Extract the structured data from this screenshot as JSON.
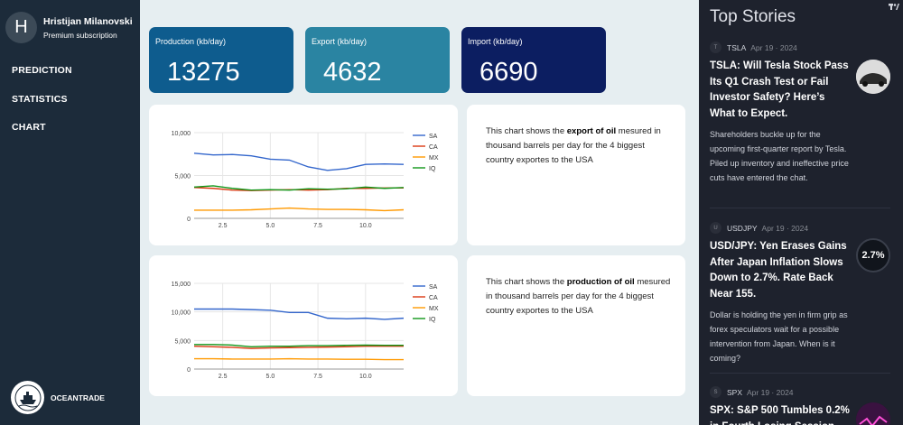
{
  "user": {
    "initial": "H",
    "name": "Hristijan Milanovski",
    "plan": "Premium subscription"
  },
  "nav": {
    "items": [
      {
        "label": "PREDICTION"
      },
      {
        "label": "STATISTICS"
      },
      {
        "label": "CHART"
      }
    ]
  },
  "brand": {
    "name": "OCEANTRADE"
  },
  "kpis": [
    {
      "label": "Production (kb/day)",
      "value": "13275",
      "color": "#0e5c8e"
    },
    {
      "label": "Export (kb/day)",
      "value": "4632",
      "color": "#2a84a2"
    },
    {
      "label": "Import (kb/day)",
      "value": "6690",
      "color": "#0c1e61"
    }
  ],
  "descriptions": [
    {
      "pre": "This chart shows the ",
      "bold": "export of oil",
      "post": " mesured in thousand barrels per day for the 4 biggest country exportes to the USA"
    },
    {
      "pre": "This chart shows the ",
      "bold": "production of oil",
      "post": " mesured in thousand barrels per day for the 4 biggest country exportes to the USA"
    }
  ],
  "chart_data": [
    {
      "type": "line",
      "x": [
        1,
        2,
        3,
        4,
        5,
        6,
        7,
        8,
        9,
        10,
        11,
        12
      ],
      "xticks": [
        "2.5",
        "5.0",
        "7.5",
        "10.0"
      ],
      "yticks": [
        "0",
        "5,000",
        "10,000"
      ],
      "ylim": [
        0,
        10000
      ],
      "xlim": [
        1,
        12
      ],
      "legend": "right",
      "grid": true,
      "series": [
        {
          "name": "SA",
          "color": "#3366cc",
          "values": [
            7600,
            7400,
            7450,
            7300,
            6900,
            6800,
            6000,
            5600,
            5800,
            6300,
            6350,
            6300
          ]
        },
        {
          "name": "CA",
          "color": "#dc3912",
          "values": [
            3600,
            3500,
            3300,
            3250,
            3300,
            3350,
            3300,
            3350,
            3500,
            3500,
            3550,
            3550
          ]
        },
        {
          "name": "MX",
          "color": "#ff9900",
          "values": [
            950,
            950,
            950,
            1000,
            1100,
            1200,
            1100,
            1050,
            1050,
            1000,
            900,
            1000
          ]
        },
        {
          "name": "IQ",
          "color": "#109618",
          "values": [
            3650,
            3800,
            3500,
            3300,
            3350,
            3300,
            3450,
            3400,
            3450,
            3650,
            3500,
            3600
          ]
        }
      ]
    },
    {
      "type": "line",
      "x": [
        1,
        2,
        3,
        4,
        5,
        6,
        7,
        8,
        9,
        10,
        11,
        12
      ],
      "xticks": [
        "2.5",
        "5.0",
        "7.5",
        "10.0"
      ],
      "yticks": [
        "0",
        "5,000",
        "10,000",
        "15,000"
      ],
      "ylim": [
        0,
        15000
      ],
      "xlim": [
        1,
        12
      ],
      "legend": "right",
      "grid": true,
      "series": [
        {
          "name": "SA",
          "color": "#3366cc",
          "values": [
            10500,
            10500,
            10500,
            10400,
            10300,
            9900,
            9900,
            8900,
            8800,
            8900,
            8700,
            8900
          ]
        },
        {
          "name": "CA",
          "color": "#dc3912",
          "values": [
            4000,
            3900,
            3800,
            3600,
            3700,
            3750,
            3800,
            3850,
            3900,
            4000,
            4000,
            4000
          ]
        },
        {
          "name": "MX",
          "color": "#ff9900",
          "values": [
            1800,
            1800,
            1750,
            1750,
            1750,
            1800,
            1750,
            1750,
            1700,
            1700,
            1650,
            1650
          ]
        },
        {
          "name": "IQ",
          "color": "#109618",
          "values": [
            4300,
            4300,
            4200,
            3900,
            4000,
            4000,
            4100,
            4100,
            4150,
            4200,
            4150,
            4150
          ]
        }
      ]
    }
  ],
  "top_stories": {
    "title": "Top Stories",
    "items": [
      {
        "symbol_icon": "T",
        "ticker": "TSLA",
        "date": "Apr 19 · 2024",
        "headline": "TSLA: Will Tesla Stock Pass Its Q1 Crash Test or Fail Investor Safety? Here’s What to Expect.",
        "summary": "Shareholders buckle up for the upcoming first-quarter report by Tesla. Piled up inventory and ineffective price cuts have entered the chat.",
        "thumb": "car-image"
      },
      {
        "symbol_icon": "U",
        "ticker": "USDJPY",
        "date": "Apr 19 · 2024",
        "headline": "USD/JPY: Yen Erases Gains After Japan Inflation Slows Down to 2.7%. Rate Back Near 155.",
        "summary": "Dollar is holding the yen in firm grip as forex speculators wait for a possible intervention from Japan. When is it coming?",
        "thumb_text": "2.7%"
      },
      {
        "symbol_icon": "S",
        "ticker": "SPX",
        "date": "Apr 19 · 2024",
        "headline": "SPX: S&P 500 Tumbles 0.2% in Fourth Losing Session",
        "summary": "",
        "thumb": "chart-image"
      }
    ]
  }
}
